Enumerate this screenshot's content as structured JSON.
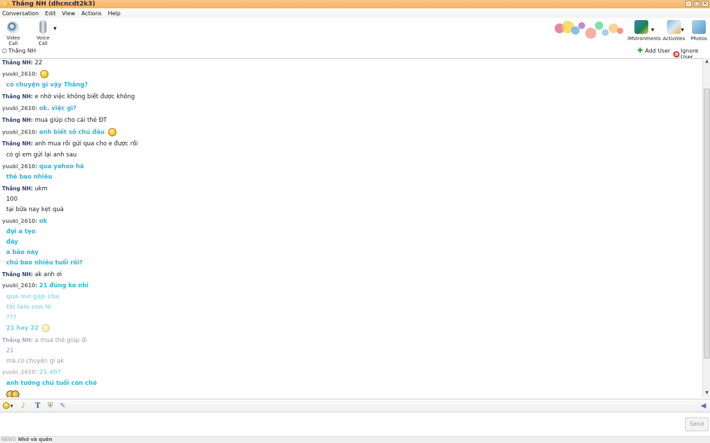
{
  "window": {
    "title": "Thắng NH (dhcncdt2k3)"
  },
  "menu": [
    "Conversation",
    "Edit",
    "View",
    "Actions",
    "Help"
  ],
  "toolbar": {
    "video_call": "Video Call",
    "voice_call": "Voice Call",
    "imvironments": "IMVironments",
    "activities": "Activities",
    "photos": "Photos"
  },
  "contact": {
    "name": "Thắng NH"
  },
  "actions": {
    "add_user": "Add User",
    "ignore_user": "Ignore User"
  },
  "messages": [
    {
      "sender": "Thắng NH:",
      "text": "22"
    },
    {
      "sender": "yuuki_2610:",
      "text": ""
    },
    {
      "sender": "",
      "text": "có chuyện gì vậy Thắng?"
    },
    {
      "sender": "Thắng NH:",
      "text": "e nhờ việc không biết được không"
    },
    {
      "sender": "yuuki_2610:",
      "text": "ok. việc gì?"
    },
    {
      "sender": "Thắng NH:",
      "text": "mua giúp cho cái thẻ ĐT"
    },
    {
      "sender": "yuuki_2610:",
      "text": "anh biết số chú đâu"
    },
    {
      "sender": "Thắng NH:",
      "text": "anh mua rồi gửi qua cho e được rồi"
    },
    {
      "sender": "",
      "text": "có gì em gửi lại anh sau"
    },
    {
      "sender": "yuuki_2610:",
      "text": "qua yahoo hả"
    },
    {
      "sender": "",
      "text": "thẻ bao nhiêu"
    },
    {
      "sender": "Thắng NH:",
      "text": "ukm"
    },
    {
      "sender": "",
      "text": "100"
    },
    {
      "sender": "",
      "text": "tại bữa nay kẹt quá"
    },
    {
      "sender": "yuuki_2610:",
      "text": "ok"
    },
    {
      "sender": "",
      "text": "đợi a tẹo"
    },
    {
      "sender": "",
      "text": "đây"
    },
    {
      "sender": "",
      "text": "a bảo này"
    },
    {
      "sender": "",
      "text": "chú bao nhiêu tuổi rồi?"
    },
    {
      "sender": "Thắng NH:",
      "text": "ak anh ơi"
    },
    {
      "sender": "yuuki_2610:",
      "text": "21 đúng ko nhỉ"
    },
    {
      "sender": "",
      "text": "quá mơ gặp chú"
    },
    {
      "sender": "",
      "text": "tối làm con lô"
    },
    {
      "sender": "",
      "text": "???"
    },
    {
      "sender": "",
      "text": "21 hay 22"
    },
    {
      "sender": "Thắng NH:",
      "text": "a mua thẻ giúp đi"
    },
    {
      "sender": "",
      "text": "21"
    },
    {
      "sender": "",
      "text": "mà có chuyện gì ak"
    },
    {
      "sender": "yuuki_2610:",
      "text": "21 àh?"
    },
    {
      "sender": "",
      "text": "anh tưởng chú tuổi con chó"
    }
  ],
  "input": {
    "send_label": "Send"
  },
  "news": {
    "label": "NEWS",
    "text": "Nhớ và quên"
  }
}
